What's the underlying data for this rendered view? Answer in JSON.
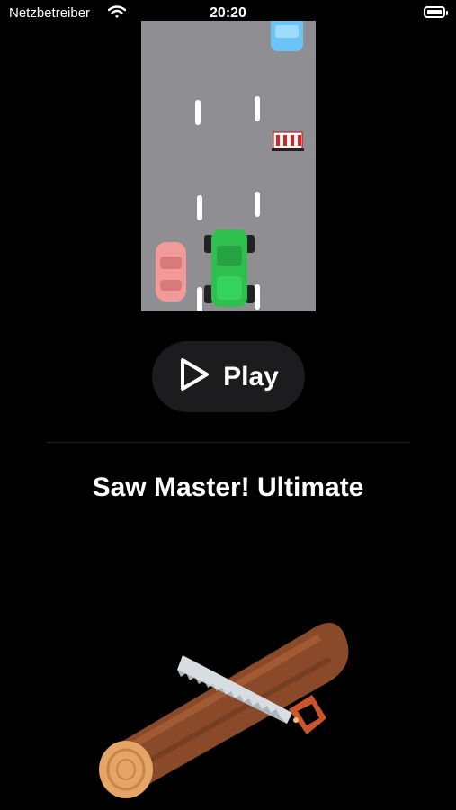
{
  "status_bar": {
    "carrier": "Netzbetreiber",
    "time": "20:20",
    "icons": [
      "wifi-icon",
      "battery-icon"
    ]
  },
  "game_preview": {
    "name": "car-racing-game-preview",
    "colors": {
      "road": "#8f8f93",
      "player_car": "#2fbf4f",
      "pink_car": "#f29a9a",
      "blue_car": "#6cc3f5"
    }
  },
  "play_button": {
    "label": "Play",
    "icon": "play-icon"
  },
  "featured_game": {
    "title": "Saw Master! Ultimate",
    "art": "saw-and-log-art"
  }
}
